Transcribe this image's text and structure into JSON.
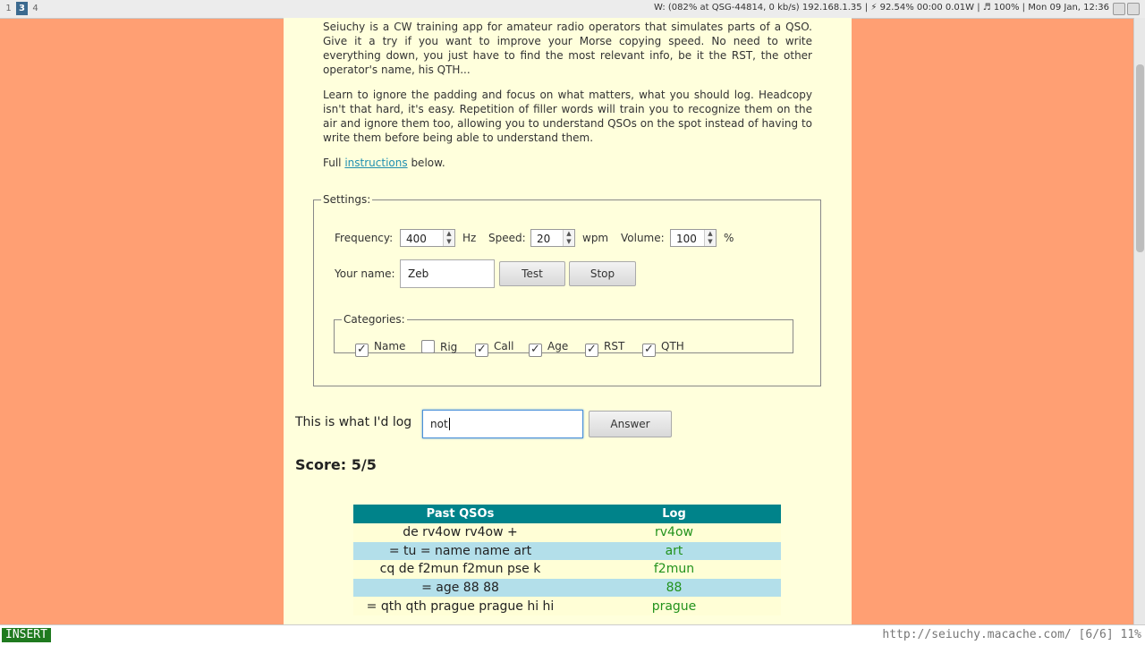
{
  "topbar": {
    "workspaces": [
      "1",
      "3",
      "4"
    ],
    "active_workspace": "3",
    "status": "W: (082% at QSG-44814, 0 kb/s) 192.168.1.35 | ⚡ 92.54% 00:00 0.01W | ♬ 100% | Mon 09 Jan, 12:36"
  },
  "intro": {
    "p1": "Seiuchy is a CW training app for amateur radio operators that simulates parts of a QSO. Give it a try if you want to improve your Morse copying speed. No need to write everything down, you just have to find the most relevant info, be it the RST, the other operator's name, his QTH...",
    "p2": "Learn to ignore the padding and focus on what matters, what you should log. Headcopy isn't that hard, it's easy. Repetition of filler words will train you to recognize them on the air and ignore them too, allowing you to understand QSOs on the spot instead of having to write them before being able to understand them.",
    "p3_prefix": "Full ",
    "p3_link": "instructions",
    "p3_suffix": " below."
  },
  "settings": {
    "legend": "Settings:",
    "frequency_label": "Frequency:",
    "frequency_value": "400",
    "frequency_unit": "Hz",
    "speed_label": "Speed:",
    "speed_value": "20",
    "speed_unit": "wpm",
    "volume_label": "Volume:",
    "volume_value": "100",
    "volume_unit": "%",
    "name_label": "Your name:",
    "name_value": "Zeb",
    "test_label": "Test",
    "stop_label": "Stop"
  },
  "categories": {
    "legend": "Categories:",
    "items": [
      {
        "label": "Name",
        "checked": true
      },
      {
        "label": "Rig",
        "checked": false
      },
      {
        "label": "Call",
        "checked": true
      },
      {
        "label": "Age",
        "checked": true
      },
      {
        "label": "RST",
        "checked": true
      },
      {
        "label": "QTH",
        "checked": true
      }
    ]
  },
  "log": {
    "label": "This is what I'd log",
    "value": "not",
    "answer_label": "Answer"
  },
  "score": "Score: 5/5",
  "table": {
    "headers": [
      "Past QSOs",
      "Log"
    ],
    "rows": [
      {
        "msg": "de rv4ow rv4ow +",
        "log": "rv4ow"
      },
      {
        "msg": "= tu = name name art",
        "log": "art"
      },
      {
        "msg": "cq de f2mun f2mun pse k",
        "log": "f2mun"
      },
      {
        "msg": "= age 88 88",
        "log": "88"
      },
      {
        "msg": "= qth qth prague prague hi hi",
        "log": "prague"
      }
    ]
  },
  "bottombar": {
    "mode": "INSERT",
    "url": "http://seiuchy.macache.com/ [6/6] 11%"
  }
}
